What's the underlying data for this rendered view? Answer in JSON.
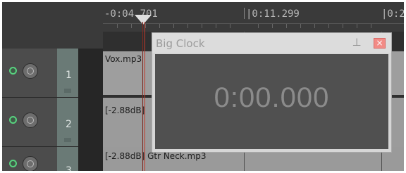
{
  "ruler": {
    "labels": [
      "-0:04.701",
      "|0:11.299",
      "|0:2"
    ]
  },
  "tracks": [
    {
      "number": "1",
      "item_label": "Vox.mp3"
    },
    {
      "number": "2",
      "item_label": "[-2.88dB]"
    },
    {
      "number": "3",
      "item_label": "[-2.88dB] Gtr Neck.mp3"
    }
  ],
  "bigclock": {
    "title": "Big Clock",
    "time": "0:00.000",
    "pin_glyph": "⊥",
    "close_glyph": "×"
  },
  "colors": {
    "playhead": "#c0392b",
    "close_button": "#f28b86",
    "track_active_icon": "#58d27f"
  }
}
